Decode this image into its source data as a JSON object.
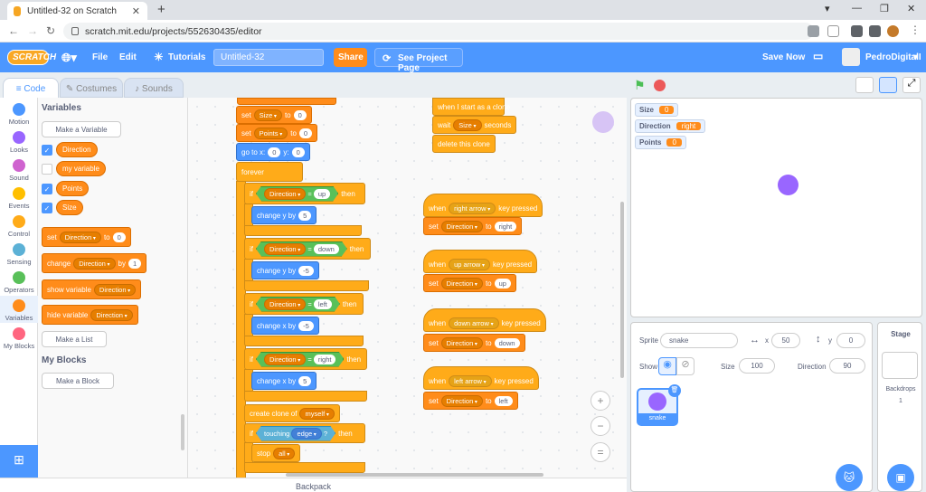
{
  "browser": {
    "tab_title": "Untitled-32 on Scratch",
    "url": "scratch.mit.edu/projects/552630435/editor"
  },
  "menubar": {
    "logo": "SCRATCH",
    "file": "File",
    "edit": "Edit",
    "tutorials": "Tutorials",
    "project_title": "Untitled-32",
    "share": "Share",
    "see_project_page": "See Project Page",
    "save_now": "Save Now",
    "username": "PedroDigitalI"
  },
  "editor_tabs": [
    "Code",
    "Costumes",
    "Sounds"
  ],
  "categories": [
    {
      "label": "Motion",
      "color": "#4c97ff"
    },
    {
      "label": "Looks",
      "color": "#9966ff"
    },
    {
      "label": "Sound",
      "color": "#cf63cf"
    },
    {
      "label": "Events",
      "color": "#ffbf00"
    },
    {
      "label": "Control",
      "color": "#ffab19"
    },
    {
      "label": "Sensing",
      "color": "#5cb1d6"
    },
    {
      "label": "Operators",
      "color": "#59c059"
    },
    {
      "label": "Variables",
      "color": "#ff8c1a"
    },
    {
      "label": "My Blocks",
      "color": "#ff6680"
    }
  ],
  "palette": {
    "variables_heading": "Variables",
    "make_variable": "Make a Variable",
    "vars": [
      {
        "name": "Direction",
        "checked": true
      },
      {
        "name": "my variable",
        "checked": false
      },
      {
        "name": "Points",
        "checked": true
      },
      {
        "name": "Size",
        "checked": true
      }
    ],
    "set_block": {
      "w1": "set",
      "var": "Direction",
      "w2": "to",
      "val": "0"
    },
    "change_block": {
      "w1": "change",
      "var": "Direction",
      "w2": "by",
      "val": "1"
    },
    "show_block": {
      "w1": "show variable",
      "var": "Direction"
    },
    "hide_block": {
      "w1": "hide variable",
      "var": "Direction"
    },
    "make_list": "Make a List",
    "myblocks_heading": "My Blocks",
    "make_block": "Make a Block"
  },
  "script_main": {
    "set_size": {
      "w1": "set",
      "var": "Size",
      "w2": "to",
      "val": "0"
    },
    "set_points": {
      "w1": "set",
      "var": "Points",
      "w2": "to",
      "val": "0"
    },
    "goto": {
      "w1": "go to x:",
      "x": "0",
      "w2": "y:",
      "y": "0"
    },
    "forever": "forever",
    "ifs": [
      {
        "if": "if",
        "var": "Direction",
        "eq": "=",
        "val": "up",
        "then": "then",
        "change": "change y by",
        "amount": "5"
      },
      {
        "if": "if",
        "var": "Direction",
        "eq": "=",
        "val": "down",
        "then": "then",
        "change": "change y by",
        "amount": "-5"
      },
      {
        "if": "if",
        "var": "Direction",
        "eq": "=",
        "val": "left",
        "then": "then",
        "change": "change x by",
        "amount": "-5"
      },
      {
        "if": "if",
        "var": "Direction",
        "eq": "=",
        "val": "right",
        "then": "then",
        "change": "change x by",
        "amount": "5"
      }
    ],
    "create_clone": {
      "w1": "create clone of",
      "target": "myself"
    },
    "if_touching": {
      "if": "if",
      "touching": "touching",
      "obj": "edge",
      "q": "?",
      "then": "then"
    },
    "stop": {
      "w1": "stop",
      "opt": "all"
    }
  },
  "script_clone": {
    "hat": "when I start as a clone",
    "wait": {
      "w1": "wait",
      "var": "Size",
      "w2": "seconds"
    },
    "delete": "delete this clone"
  },
  "key_scripts": [
    {
      "when": "when",
      "key": "right arrow",
      "pressed": "key pressed",
      "set": "set",
      "var": "Direction",
      "to": "to",
      "val": "right"
    },
    {
      "when": "when",
      "key": "up arrow",
      "pressed": "key pressed",
      "set": "set",
      "var": "Direction",
      "to": "to",
      "val": "up"
    },
    {
      "when": "when",
      "key": "down arrow",
      "pressed": "key pressed",
      "set": "set",
      "var": "Direction",
      "to": "to",
      "val": "down"
    },
    {
      "when": "when",
      "key": "left arrow",
      "pressed": "key pressed",
      "set": "set",
      "var": "Direction",
      "to": "to",
      "val": "left"
    }
  ],
  "backpack": "Backpack",
  "monitors": [
    {
      "name": "Size",
      "value": "0"
    },
    {
      "name": "Direction",
      "value": "right"
    },
    {
      "name": "Points",
      "value": "0"
    }
  ],
  "sprite_info": {
    "sprite_label": "Sprite",
    "sprite_name": "snake",
    "x_label": "x",
    "x": "50",
    "y_label": "y",
    "y": "0",
    "show_label": "Show",
    "size_label": "Size",
    "size": "100",
    "direction_label": "Direction",
    "direction": "90",
    "thumb_name": "snake"
  },
  "stage_panel": {
    "title": "Stage",
    "backdrops_label": "Backdrops",
    "backdrops_count": "1"
  },
  "colors": {
    "sprite": "#9966ff",
    "variables": "#ff8c1a",
    "accent": "#4c97ff"
  }
}
